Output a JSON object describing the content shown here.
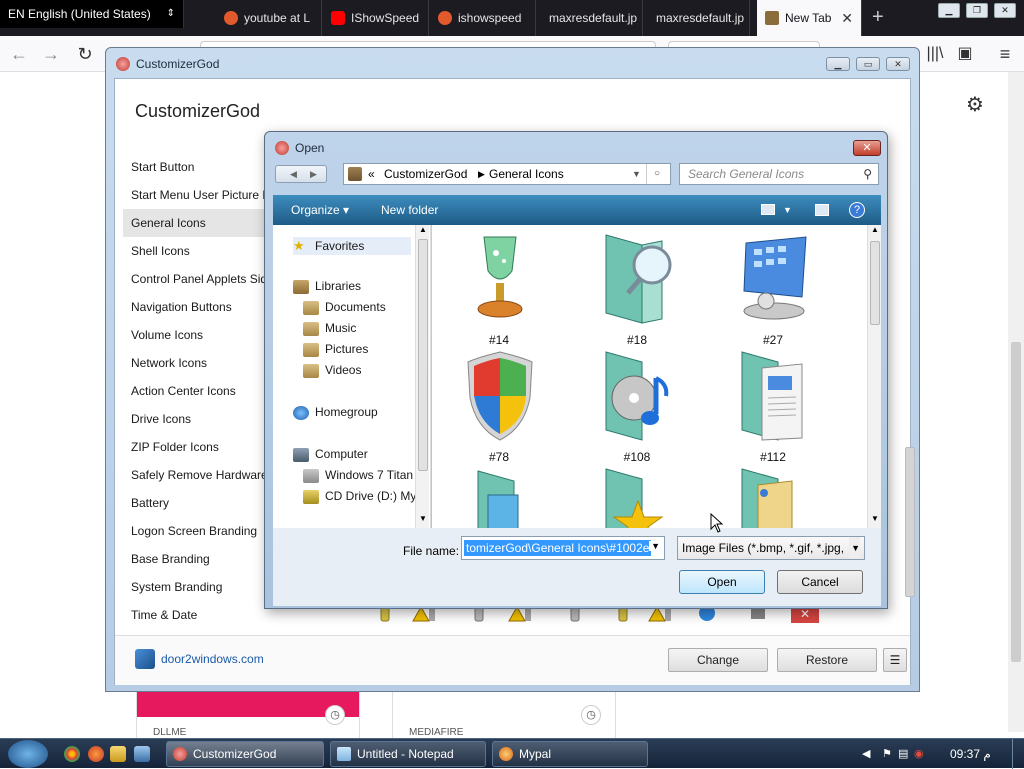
{
  "browser": {
    "language": "EN English (United States)",
    "tabs": [
      {
        "label": "youtube at L",
        "color": "#e25a2b"
      },
      {
        "label": "IShowSpeed",
        "color": "#ff0000"
      },
      {
        "label": "ishowspeed",
        "color": "#e25a2b"
      },
      {
        "label": "maxresdefault.jp"
      },
      {
        "label": "maxresdefault.jp"
      },
      {
        "label": "New Tab",
        "active": true
      }
    ],
    "page_cards": [
      {
        "label": "DLLME"
      },
      {
        "label": "MEDIAFIRE"
      }
    ]
  },
  "customizer": {
    "window_title": "CustomizerGod",
    "app_title": "CustomizerGod",
    "sidebar": [
      "Start Button",
      "Start Menu User Picture F",
      "General Icons",
      "Shell Icons",
      "Control Panel Applets Side",
      "Navigation Buttons",
      "Volume Icons",
      "Network Icons",
      "Action Center Icons",
      "Drive Icons",
      "ZIP Folder Icons",
      "Safely Remove Hardware",
      "Battery",
      "Logon Screen Branding",
      "Base Branding",
      "System Branding",
      "Time & Date"
    ],
    "selected_item": "General Icons",
    "footer_link": "door2windows.com",
    "change_label": "Change",
    "restore_label": "Restore",
    "menu_label": "☰"
  },
  "dialog": {
    "title": "Open",
    "breadcrumb_prefix": "«",
    "breadcrumb": [
      "CustomizerGod",
      "General Icons"
    ],
    "search_placeholder": "Search General Icons",
    "organize_label": "Organize ▾",
    "new_folder_label": "New folder",
    "nav": {
      "favorites": "Favorites",
      "libraries": "Libraries",
      "documents": "Documents",
      "music": "Music",
      "pictures": "Pictures",
      "videos": "Videos",
      "homegroup": "Homegroup",
      "computer": "Computer",
      "windows_drive": "Windows 7 Titan",
      "cd_drive": "CD Drive (D:) My"
    },
    "files": [
      {
        "label": "#14",
        "icon": "trophy-icon"
      },
      {
        "label": "#18",
        "icon": "folder-search-icon"
      },
      {
        "label": "#27",
        "icon": "control-panel-icon"
      },
      {
        "label": "#78",
        "icon": "windows-shield-icon"
      },
      {
        "label": "#108",
        "icon": "music-folder-icon"
      },
      {
        "label": "#112",
        "icon": "documents-folder-icon"
      },
      {
        "label": "",
        "icon": "pictures-folder-icon"
      },
      {
        "label": "",
        "icon": "favorites-folder-icon"
      },
      {
        "label": "",
        "icon": "user-folder-icon"
      }
    ],
    "file_name_label": "File name:",
    "file_name_value": "tomizerGod\\General Icons\\#1002e",
    "file_type": "Image Files (*.bmp, *.gif, *.jpg,",
    "open_label": "Open",
    "cancel_label": "Cancel"
  },
  "taskbar": {
    "buttons": [
      {
        "label": "CustomizerGod",
        "active": true
      },
      {
        "label": "Untitled - Notepad"
      },
      {
        "label": "Mypal"
      }
    ],
    "clock": "09:37 م"
  }
}
